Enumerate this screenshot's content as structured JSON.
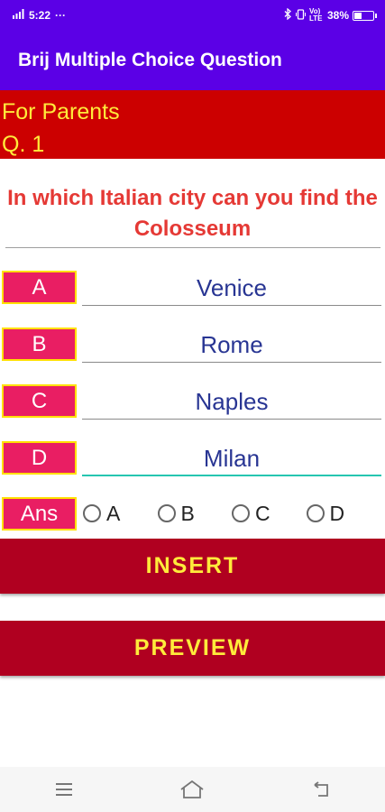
{
  "status_bar": {
    "time": "5:22",
    "dots": "···",
    "signal": "Vo) LTE",
    "battery": "38%",
    "battery_level": 0.38
  },
  "app_bar": {
    "title": "Brij Multiple Choice Question"
  },
  "header": {
    "category": "For Parents",
    "question_number": "Q. 1"
  },
  "question": {
    "text": "In which Italian city can you find the Colosseum"
  },
  "options": [
    {
      "letter": "A",
      "value": "Venice"
    },
    {
      "letter": "B",
      "value": "Rome"
    },
    {
      "letter": "C",
      "value": "Naples"
    },
    {
      "letter": "D",
      "value": "Milan"
    }
  ],
  "answer": {
    "label": "Ans",
    "choices": [
      "A",
      "B",
      "C",
      "D"
    ]
  },
  "buttons": {
    "insert": "INSERT",
    "preview": "PREVIEW"
  },
  "nav": [
    "menu-icon",
    "home-icon",
    "back-icon"
  ],
  "colors": {
    "app_bar": "#5b00e6",
    "header_panel": "#cc0000",
    "header_text": "#ffeb3b",
    "question_text": "#e53935",
    "option_label_bg": "#e91e63",
    "option_label_border": "#ffe000",
    "option_value_text": "#283593",
    "active_underline": "#26c6b0",
    "button_bg": "#b00020",
    "button_text": "#ffeb3b"
  }
}
